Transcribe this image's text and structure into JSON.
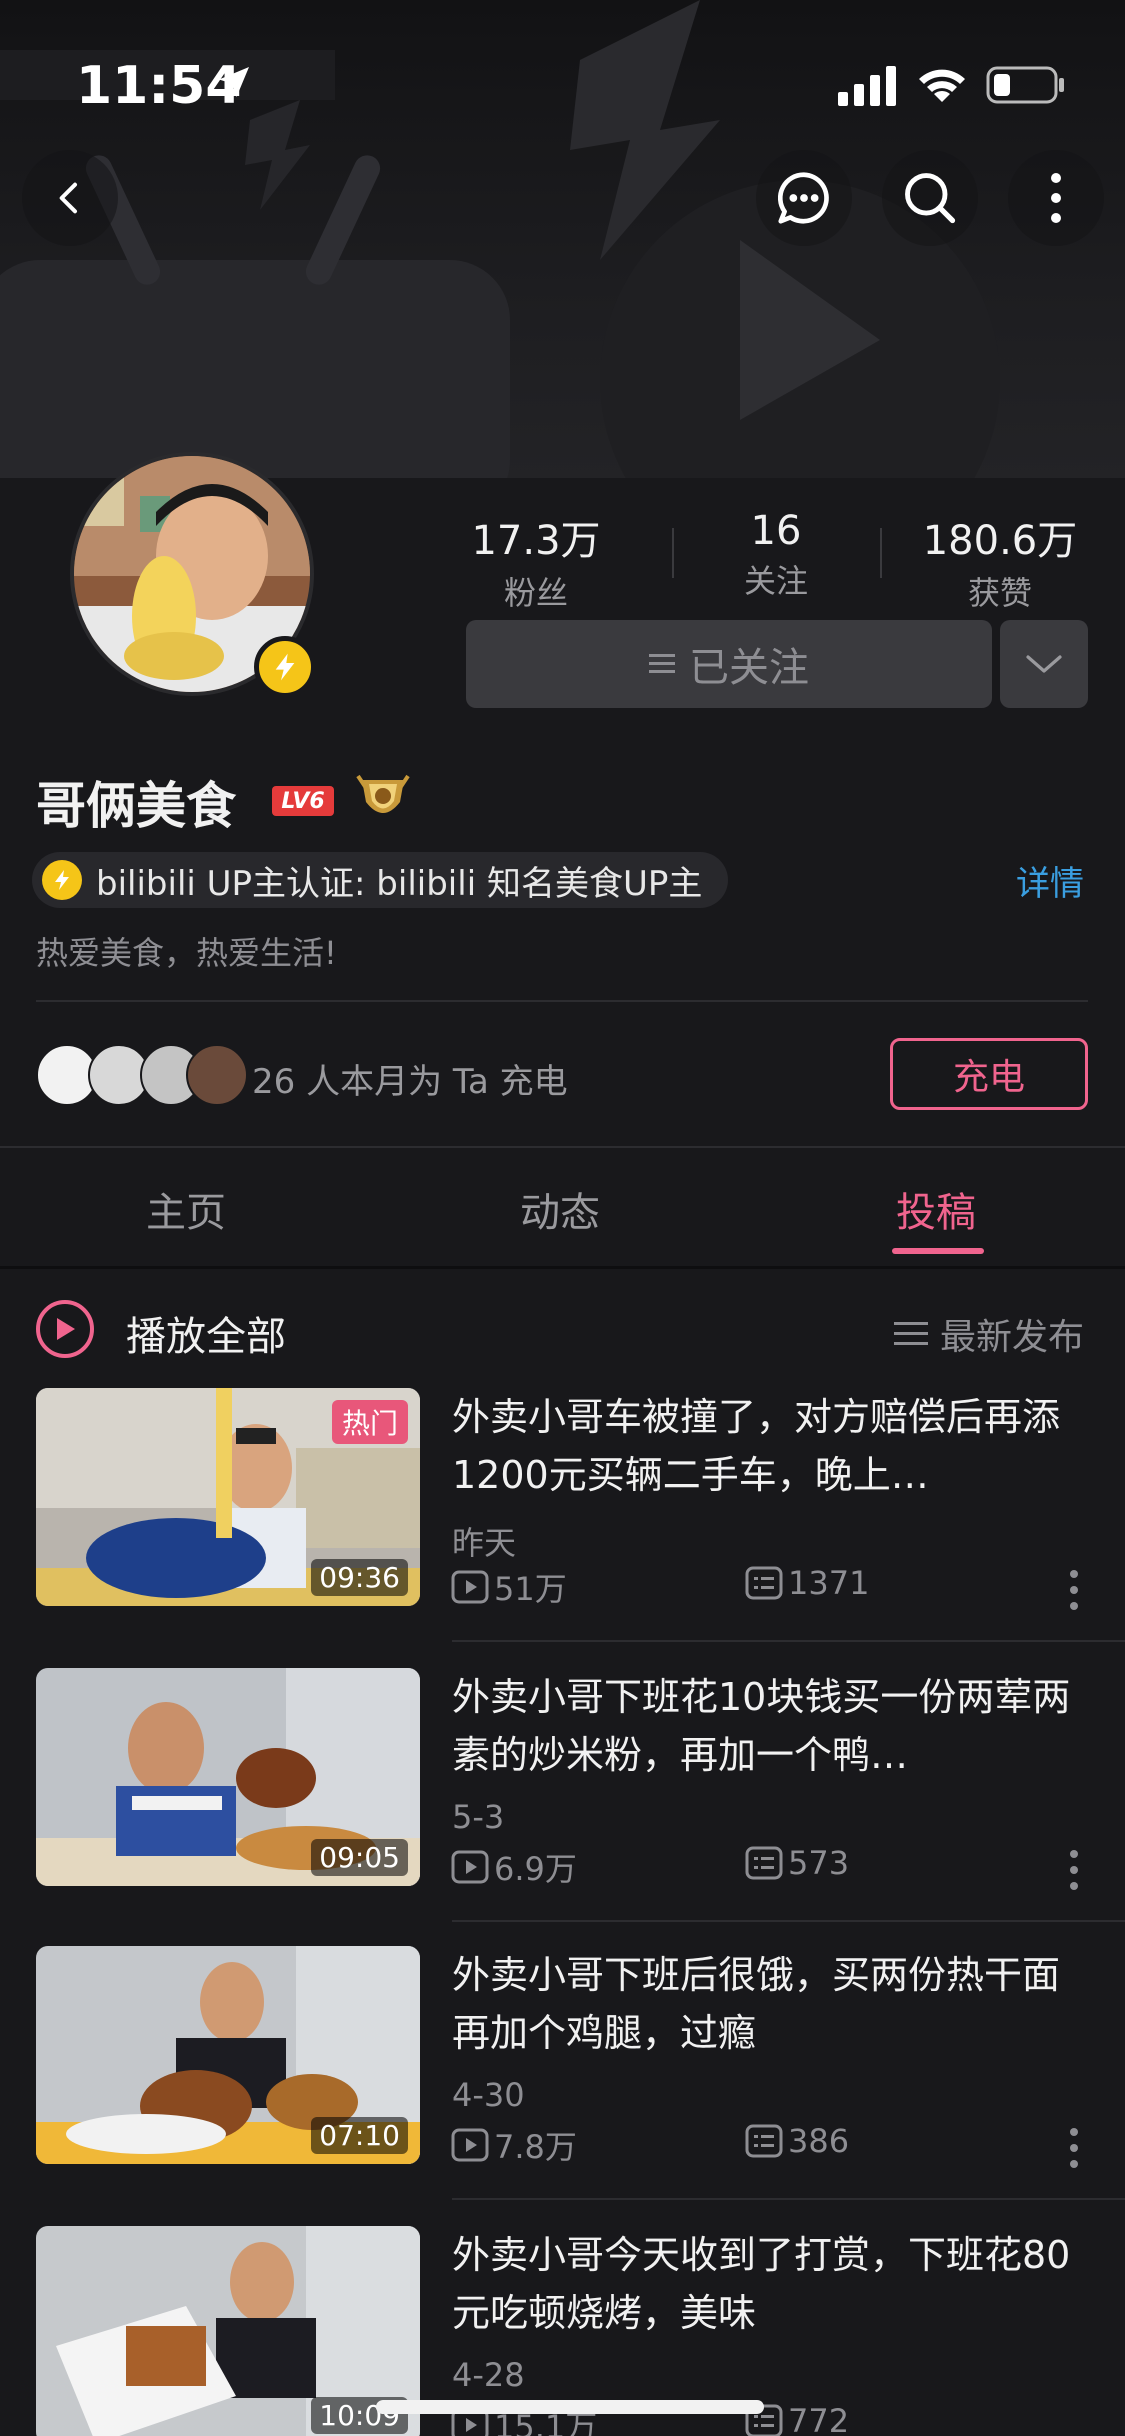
{
  "status_bar": {
    "time": "11:54"
  },
  "profile": {
    "stats": [
      {
        "value": "17.3万",
        "label": "粉丝"
      },
      {
        "value": "16",
        "label": "关注"
      },
      {
        "value": "180.6万",
        "label": "获赞"
      }
    ],
    "follow_label": "已关注",
    "name": "哥俩美食",
    "level": "LV6",
    "verify_text": "bilibili UP主认证: bilibili 知名美食UP主",
    "detail_link": "详情",
    "bio": "热爱美食，热爱生活!",
    "supporters_text": "26 人本月为 Ta 充电",
    "charge_label": "充电"
  },
  "tabs": [
    {
      "label": "主页",
      "active": false
    },
    {
      "label": "动态",
      "active": false
    },
    {
      "label": "投稿",
      "active": true
    }
  ],
  "list_header": {
    "play_all": "播放全部",
    "sort": "最新发布"
  },
  "videos": [
    {
      "title": "外卖小哥车被撞了，对方赔偿后再添1200元买辆二手车，晚上…",
      "date": "昨天",
      "views": "51万",
      "comments": "1371",
      "duration": "09:36",
      "tag": "热门"
    },
    {
      "title": "外卖小哥下班花10块钱买一份两荤两素的炒米粉，再加一个鸭…",
      "date": "5-3",
      "views": "6.9万",
      "comments": "573",
      "duration": "09:05"
    },
    {
      "title": "外卖小哥下班后很饿，买两份热干面再加个鸡腿，过瘾",
      "date": "4-30",
      "views": "7.8万",
      "comments": "386",
      "duration": "07:10"
    },
    {
      "title": "外卖小哥今天收到了打赏，下班花80元吃顿烧烤，美味",
      "date": "4-28",
      "views": "15.1万",
      "comments": "772",
      "duration": "10:09"
    }
  ],
  "colors": {
    "accent": "#f0648e",
    "link": "#3a9ee0",
    "background": "#18181b",
    "gold": "#f5c518"
  }
}
